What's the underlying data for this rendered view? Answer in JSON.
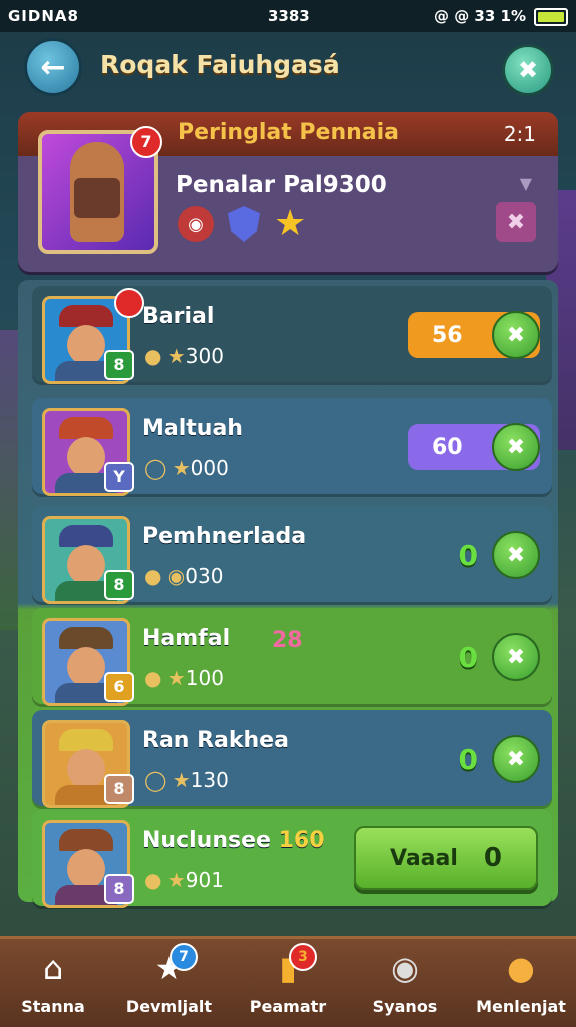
{
  "status_bar": {
    "left": "GIDNA8",
    "time": "3383",
    "right": "@ @ 33 1%"
  },
  "header": {
    "title": "Roqak Faiuhgasá"
  },
  "top_card": {
    "bar_title": "Peringlat Pennaia",
    "score": "2:1",
    "subtitle": "Penalar Pal9300",
    "notif_count": "7"
  },
  "players": [
    {
      "name": "Barial",
      "stat": "300",
      "level": "8",
      "action": "56",
      "action_color": "#f09a20"
    },
    {
      "name": "Maltuah",
      "stat": "000",
      "level": "Y",
      "action": "60",
      "action_color": "#8a6ae8"
    },
    {
      "name": "Pemhnerlada",
      "stat": "030",
      "level": "8",
      "action": "0"
    },
    {
      "name": "Hamfal",
      "stat": "100",
      "level": "6",
      "action": "0",
      "extra": "28"
    },
    {
      "name": "Ran Rakhea",
      "stat": "130",
      "level": "8",
      "action": "0"
    },
    {
      "name": "Nuclunsee",
      "stat": "901",
      "level": "8",
      "extra": "160",
      "button_label": "Vaaal",
      "button_value": "0"
    }
  ],
  "nav": [
    {
      "label": "Stanna",
      "icon": "home-icon"
    },
    {
      "label": "Devmljalt",
      "icon": "star-icon",
      "badge": "7"
    },
    {
      "label": "Peamatr",
      "icon": "cards-icon",
      "badge": "3"
    },
    {
      "label": "Syanos",
      "icon": "ghost-icon"
    },
    {
      "label": "Menlenjat",
      "icon": "helmet-icon"
    }
  ],
  "colors": {
    "accent": "#5ab040",
    "title": "#f5e2a8",
    "bar": "#9a3a26"
  }
}
